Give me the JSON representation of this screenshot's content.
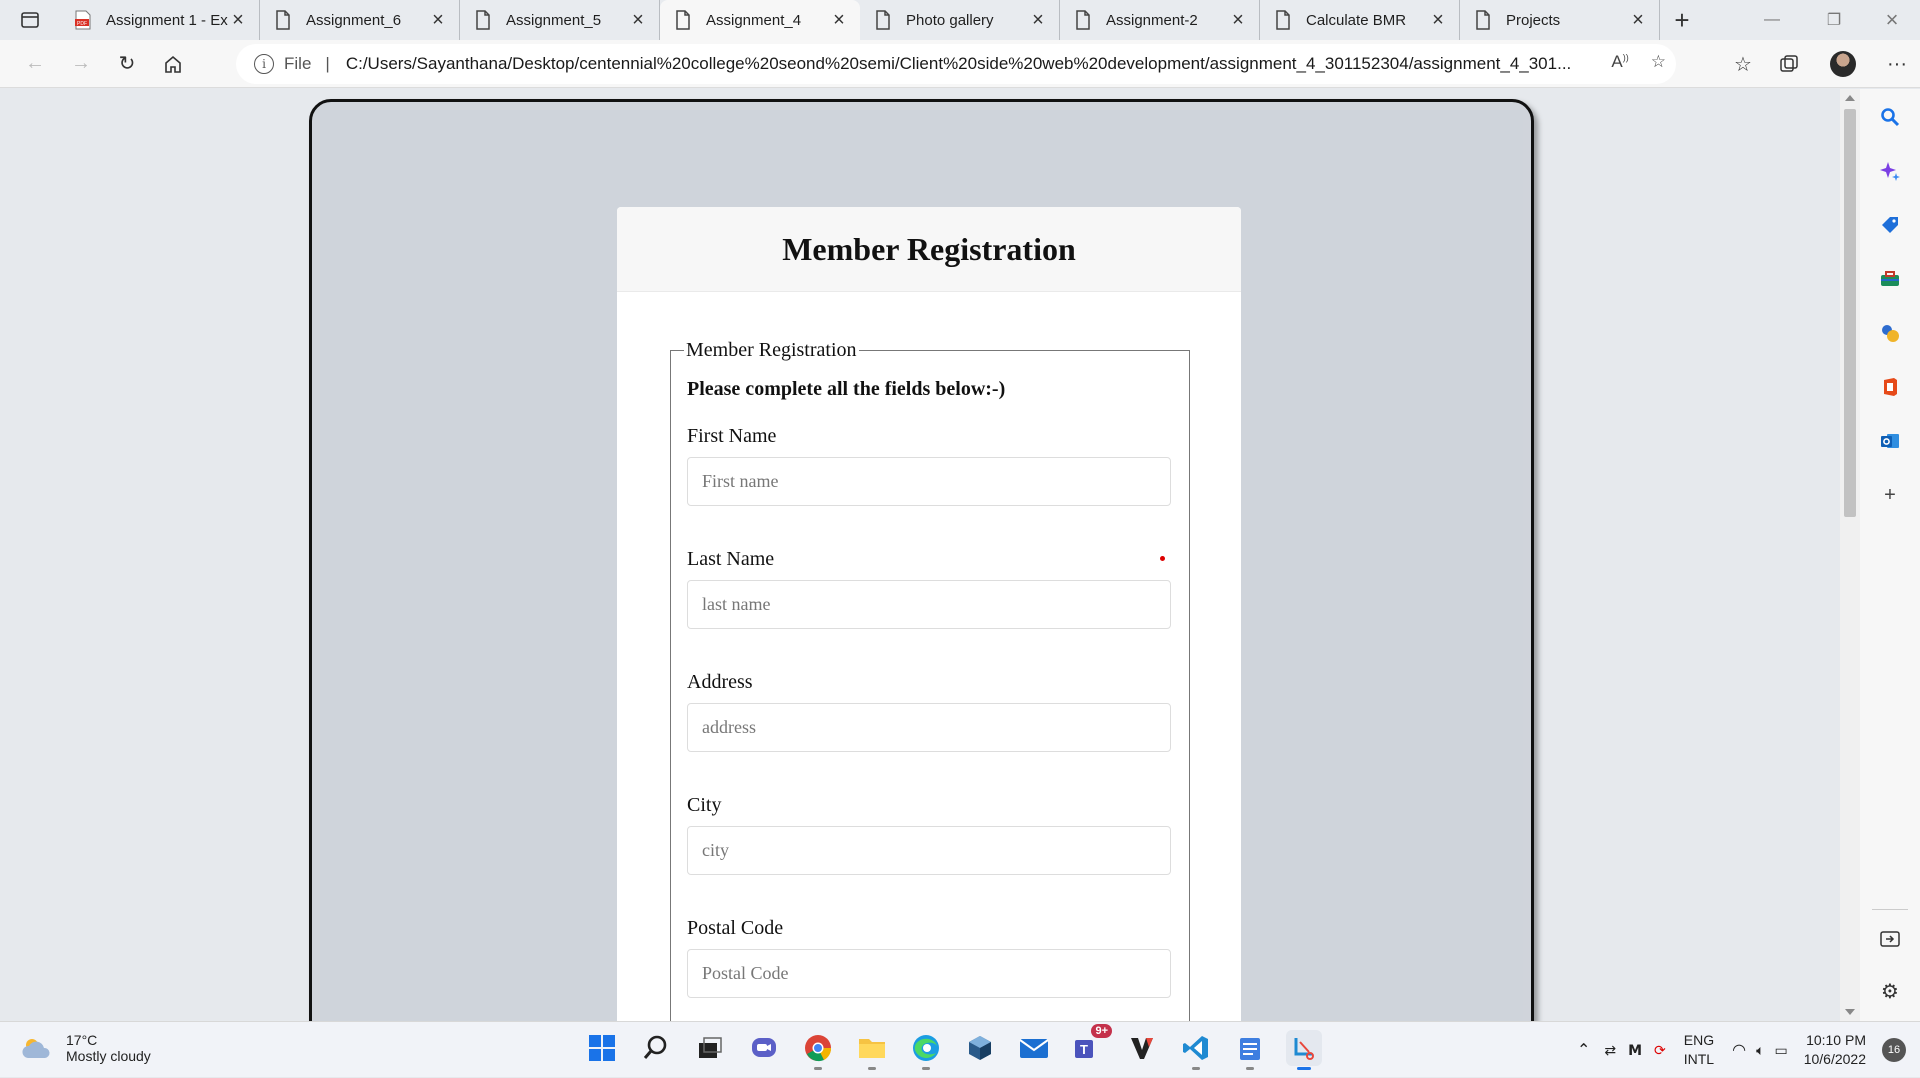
{
  "browser": {
    "tabs": [
      {
        "label": "Assignment 1 - Ex",
        "icon": "pdf-icon",
        "active": false
      },
      {
        "label": "Assignment_6",
        "icon": "page-icon",
        "active": false
      },
      {
        "label": "Assignment_5",
        "icon": "page-icon",
        "active": false
      },
      {
        "label": "Assignment_4",
        "icon": "page-icon",
        "active": true
      },
      {
        "label": "Photo gallery",
        "icon": "page-icon",
        "active": false
      },
      {
        "label": "Assignment-2",
        "icon": "page-icon",
        "active": false
      },
      {
        "label": "Calculate BMR",
        "icon": "page-icon",
        "active": false
      },
      {
        "label": "Projects",
        "icon": "page-icon",
        "active": false
      }
    ],
    "address": {
      "scheme_label": "File",
      "url": "C:/Users/Sayanthana/Desktop/centennial%20college%20seond%20semi/Client%20side%20web%20development/assignment_4_301152304/assignment_4_301..."
    }
  },
  "page": {
    "header_title": "Member Registration",
    "fieldset_legend": "Member Registration",
    "intro": "Please complete all the fields below:-)",
    "fields": [
      {
        "label": "First Name",
        "placeholder": "First name"
      },
      {
        "label": "Last Name",
        "placeholder": "last name"
      },
      {
        "label": "Address",
        "placeholder": "address"
      },
      {
        "label": "City",
        "placeholder": "city"
      },
      {
        "label": "Postal Code",
        "placeholder": "Postal Code"
      }
    ]
  },
  "taskbar": {
    "weather_temp": "17°C",
    "weather_desc": "Mostly cloudy",
    "lang_top": "ENG",
    "lang_bottom": "INTL",
    "time": "10:10 PM",
    "date": "10/6/2022",
    "notification_count": "16",
    "teams_badge": "9+"
  },
  "colors": {
    "page_bg": "#d0d4db",
    "required_dot": "#dd0000",
    "edge_search": "#1a73e8"
  }
}
